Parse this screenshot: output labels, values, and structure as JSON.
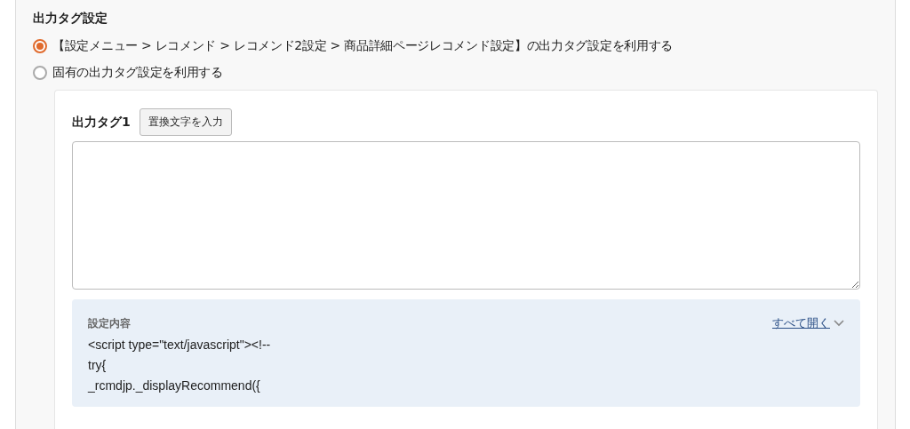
{
  "section": {
    "title": "出力タグ設定"
  },
  "options": [
    {
      "label": "【設定メニュー > レコメンド > レコメンド2設定 > 商品詳細ページレコメンド設定】の出力タグ設定を利用する",
      "selected": true
    },
    {
      "label": "固有の出力タグ設定を利用する",
      "selected": false
    }
  ],
  "tag": {
    "label": "出力タグ1",
    "button": "置換文字を入力"
  },
  "settings": {
    "title": "設定内容",
    "expand_link": "すべて開く",
    "expanded": false,
    "code_lines": [
      "<script type=\"text/javascript\"><!--",
      "try{",
      "_rcmdjp._displayRecommend({"
    ]
  }
}
